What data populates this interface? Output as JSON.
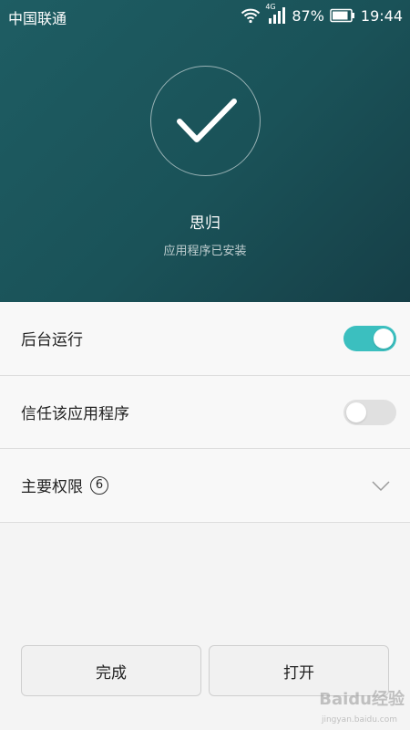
{
  "status_bar": {
    "carrier": "中国联通",
    "network_type": "4G",
    "battery_percent": "87%",
    "battery_level": 0.87,
    "time": "19:44"
  },
  "header": {
    "icon": "checkmark-icon",
    "app_name": "思归",
    "install_status": "应用程序已安装"
  },
  "settings": {
    "background_run": {
      "label": "后台运行",
      "enabled": true
    },
    "trust_app": {
      "label": "信任该应用程序",
      "enabled": false
    },
    "main_permissions": {
      "label": "主要权限",
      "count": "6"
    }
  },
  "buttons": {
    "done_label": "完成",
    "open_label": "打开"
  },
  "watermark": {
    "text": "Baidu经验",
    "sub": "jingyan.baidu.com"
  },
  "colors": {
    "header_bg": "#1a5258",
    "toggle_on": "#3bbfbf",
    "toggle_off": "#e0e0e0"
  }
}
